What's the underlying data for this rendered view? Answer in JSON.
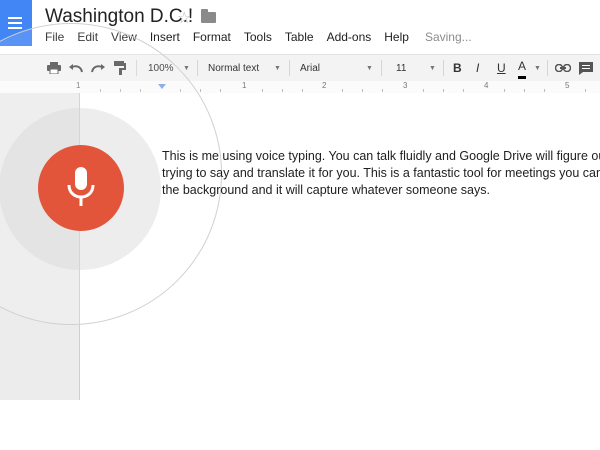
{
  "header": {
    "title": "Washington D.C.!",
    "menu": [
      "File",
      "Edit",
      "View",
      "Insert",
      "Format",
      "Tools",
      "Table",
      "Add-ons",
      "Help"
    ],
    "status": "Saving..."
  },
  "toolbar": {
    "zoom": "100%",
    "style": "Normal text",
    "font": "Arial",
    "size": "11",
    "bold": "B",
    "italic": "I",
    "underline": "U",
    "text_color": "A",
    "text_color_value": "#000000"
  },
  "ruler": {
    "labels": [
      "1",
      "1",
      "2",
      "3",
      "4",
      "5"
    ]
  },
  "voice_typing": {
    "mic_color": "#e3553a"
  },
  "document": {
    "lines": [
      "This is me using voice typing. You can talk fluidly and Google Drive will figure out",
      "trying to say and translate it for you. This is a fantastic tool for meetings you can le",
      "the background and it will capture whatever someone says."
    ]
  },
  "colors": {
    "brand": "#4285f4",
    "toolbar_bg": "#f3f3f3",
    "gutter": "#ececec"
  }
}
